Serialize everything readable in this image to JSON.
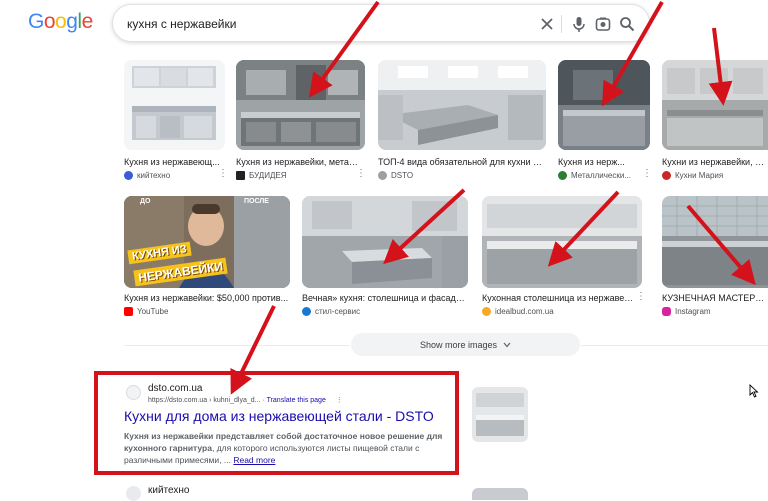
{
  "header": {
    "logo_letters": [
      {
        "ch": "G",
        "color": "#4285F4"
      },
      {
        "ch": "o",
        "color": "#EA4335"
      },
      {
        "ch": "o",
        "color": "#FBBC05"
      },
      {
        "ch": "g",
        "color": "#4285F4"
      },
      {
        "ch": "l",
        "color": "#34A853"
      },
      {
        "ch": "e",
        "color": "#EA4335"
      }
    ],
    "search_query": "кухня с нержавейки",
    "icons": [
      "close-icon",
      "mic-icon",
      "lens-icon",
      "search-icon"
    ]
  },
  "images": {
    "row1": [
      {
        "caption": "Кухня из нержавеющ...",
        "source": "кийтехно",
        "favicon_color": "#3b5bdb"
      },
      {
        "caption": "Кухня из нержавейки, метал...",
        "source": "БУДИДЕЯ",
        "favicon_color": "#202124"
      },
      {
        "caption": "ТОП-4 вида обязательной для кухни м...",
        "source": "DSTO",
        "favicon_color": "#9aa0a6"
      },
      {
        "caption": "Кухня из нерж...",
        "source": "Металлически...",
        "favicon_color": "#2e7d32"
      },
      {
        "caption": "Кухни из нержавейки, лак",
        "source": "Кухни Мария",
        "favicon_color": "#c62828"
      }
    ],
    "row2": [
      {
        "caption": "Кухня из нержавейки: $50,000 против...",
        "source": "YouTube",
        "favicon_color": "#ff0000",
        "overlay_top": "КУХНЯ ИЗ",
        "overlay_bottom": "НЕРЖАВЕЙКИ",
        "overlay_tag_left": "ДО",
        "overlay_tag_right": "ПОСЛЕ"
      },
      {
        "caption": "Вечная» кухня: столешница и фасады...",
        "source": "стил-сервис",
        "favicon_color": "#1976d2"
      },
      {
        "caption": "Кухонная столешница из нержавейк...",
        "source": "idealbud.com.ua",
        "favicon_color": "#f9a825"
      },
      {
        "caption": "КУЗНЕЧНАЯ МАСТЕРСКАЯ",
        "source": "Instagram",
        "favicon_color": "#d6249f"
      }
    ]
  },
  "show_more": {
    "label": "Show more images"
  },
  "result": {
    "site_name": "dsto.com.ua",
    "url": "https://dsto.com.ua › kuhni_dlya_d...",
    "translate": "Translate this page",
    "title": "Кухни для дома из нержавеющей стали - DSTO",
    "snippet_bold": "Кухня из нержавейки представляет собой достаточное новое решение для кухонного гарнитура",
    "snippet_rest": ", для которого используются листы пищевой стали с различными примесями, ...",
    "read_more": "Read more"
  },
  "next_result": {
    "site_name": "кийтехно"
  },
  "colors": {
    "annotation": "#d4121b",
    "link": "#1a0dab"
  }
}
